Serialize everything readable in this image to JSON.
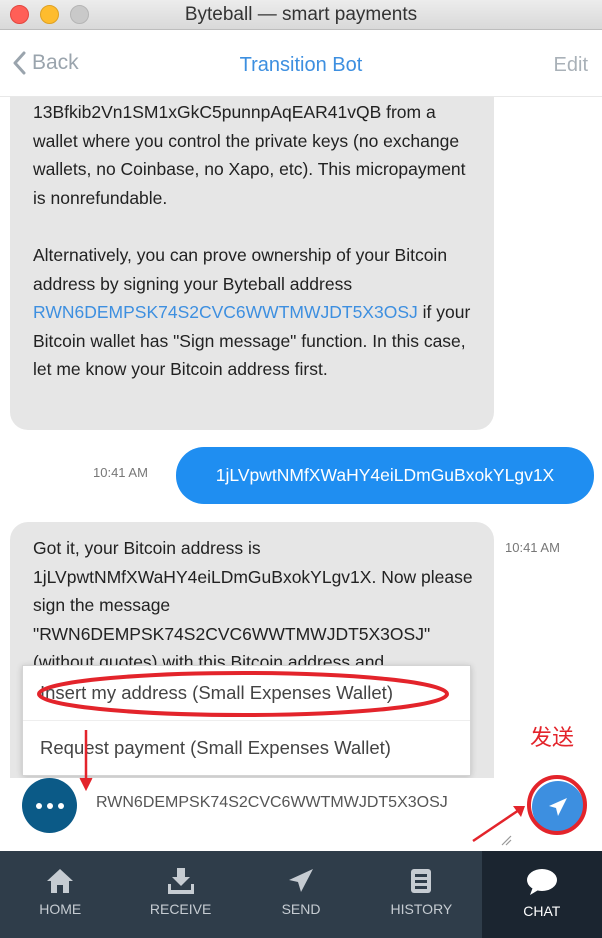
{
  "window": {
    "title": "Byteball — smart payments"
  },
  "nav": {
    "back_label": "Back",
    "title": "Transition Bot",
    "edit_label": "Edit"
  },
  "messages": {
    "m1": {
      "p1": "13Bfkib2Vn1SM1xGkC5punnpAqEAR41vQB from a wallet where you control the private keys (no exchange wallets, no Coinbase, no Xapo, etc). This micropayment is nonrefundable.",
      "p2_before": "Alternatively, you can prove ownership of your Bitcoin address by signing your Byteball address ",
      "p2_link": "RWN6DEMPSK74S2CVC6WWTMWJDT5X3OSJ",
      "p2_after": " if your Bitcoin wallet has \"Sign message\" function. In this case, let me know your Bitcoin address first."
    },
    "m2": {
      "time": "10:41 AM",
      "text": "1jLVpwtNMfXWaHY4eiLDmGuBxokYLgv1X"
    },
    "m3": {
      "time": "10:41 AM",
      "text": "Got it, your Bitcoin address is 1jLVpwtNMfXWaHY4eiLDmGuBxokYLgv1X. Now please sign the message \"RWN6DEMPSK74S2CVC6WWTMWJDT5X3OSJ\" (without quotes) with this Bitcoin address and"
    }
  },
  "popup": {
    "items": [
      {
        "label": "Insert my address (Small Expenses Wallet)"
      },
      {
        "label": "Request payment (Small Expenses Wallet)"
      }
    ]
  },
  "input": {
    "value": "RWN6DEMPSK74S2CVC6WWTMWJDT5X3OSJ"
  },
  "annotation": {
    "label": "发送",
    "color": "#e3242b"
  },
  "tabs": [
    {
      "label": "HOME",
      "icon": "home-icon"
    },
    {
      "label": "RECEIVE",
      "icon": "download-icon"
    },
    {
      "label": "SEND",
      "icon": "paper-plane-icon"
    },
    {
      "label": "HISTORY",
      "icon": "history-icon"
    },
    {
      "label": "CHAT",
      "icon": "chat-bubble-icon",
      "active": true
    }
  ],
  "colors": {
    "accent": "#3d8fe0",
    "outgoing_bubble": "#1f8ef1",
    "tabbar": "#2f3d4a",
    "more_button": "#0b5a87"
  }
}
